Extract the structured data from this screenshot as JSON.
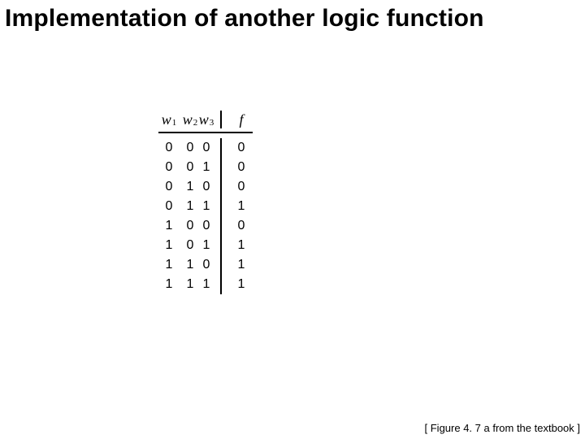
{
  "title": "Implementation of another logic function",
  "table": {
    "headers": {
      "w1": {
        "base": "w",
        "sub": "1"
      },
      "w2": {
        "base": "w",
        "sub": "2"
      },
      "w3": {
        "base": "w",
        "sub": "3"
      },
      "f": {
        "base": "f"
      }
    },
    "rows": [
      {
        "w1": "0",
        "w2": "0",
        "w3": "0",
        "f": "0"
      },
      {
        "w1": "0",
        "w2": "0",
        "w3": "1",
        "f": "0"
      },
      {
        "w1": "0",
        "w2": "1",
        "w3": "0",
        "f": "0"
      },
      {
        "w1": "0",
        "w2": "1",
        "w3": "1",
        "f": "1"
      },
      {
        "w1": "1",
        "w2": "0",
        "w3": "0",
        "f": "0"
      },
      {
        "w1": "1",
        "w2": "0",
        "w3": "1",
        "f": "1"
      },
      {
        "w1": "1",
        "w2": "1",
        "w3": "0",
        "f": "1"
      },
      {
        "w1": "1",
        "w2": "1",
        "w3": "1",
        "f": "1"
      }
    ]
  },
  "caption": "[ Figure 4. 7 a from the textbook ]",
  "chart_data": {
    "type": "table",
    "title": "Implementation of another logic function",
    "columns": [
      "w1",
      "w2",
      "w3",
      "f"
    ],
    "rows": [
      [
        0,
        0,
        0,
        0
      ],
      [
        0,
        0,
        1,
        0
      ],
      [
        0,
        1,
        0,
        0
      ],
      [
        0,
        1,
        1,
        1
      ],
      [
        1,
        0,
        0,
        0
      ],
      [
        1,
        0,
        1,
        1
      ],
      [
        1,
        1,
        0,
        1
      ],
      [
        1,
        1,
        1,
        1
      ]
    ]
  }
}
